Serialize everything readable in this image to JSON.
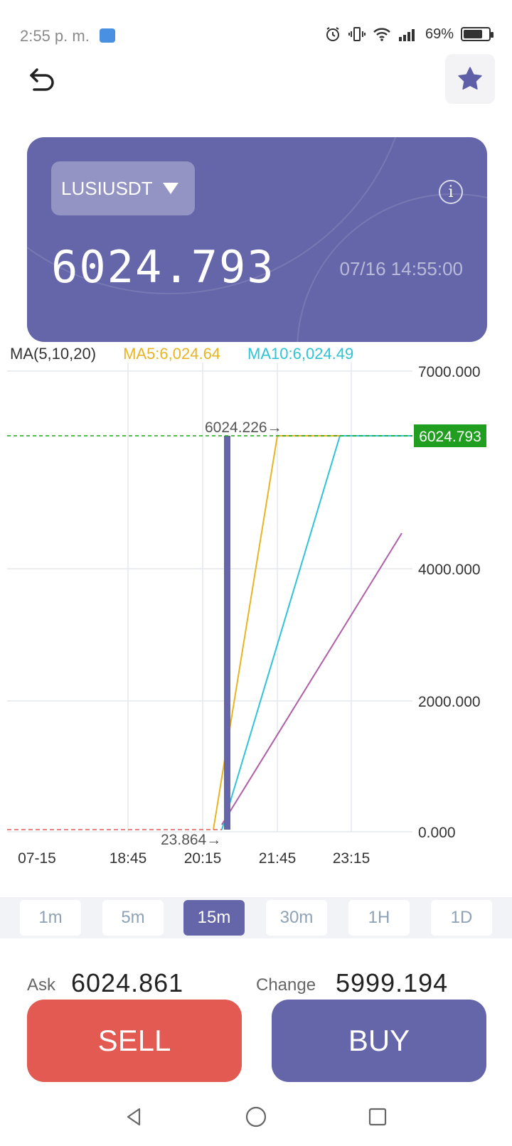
{
  "status_bar": {
    "time": "2:55 p. m.",
    "battery": "69%",
    "icons": [
      "voicemail-icon",
      "alarm-icon",
      "vibrate-icon",
      "wifi-icon",
      "signal-icon",
      "battery-icon"
    ]
  },
  "header": {
    "back_icon": "back-arrow-icon",
    "favorite_icon": "star-icon"
  },
  "ticker": {
    "symbol": "LUSIUSDT",
    "price": "6024.793",
    "timestamp": "07/16 14:55:00",
    "info_icon": "info-icon"
  },
  "indicators": {
    "label": "MA(5,10,20)",
    "ma5": "MA5:6,024.64",
    "ma10": "MA10:6,024.49"
  },
  "chart_data": {
    "type": "candlestick",
    "y_ticks": [
      "7000.000",
      "4000.000",
      "2000.000",
      "0.000"
    ],
    "y_tick_values": [
      7000,
      4000,
      2000,
      0
    ],
    "x_ticks": [
      "07-15",
      "18:45",
      "20:15",
      "21:45",
      "23:15"
    ],
    "current_price_label": "6024.793",
    "current_price": 6024.793,
    "high_marker": "6024.226→",
    "low_marker": "23.864→",
    "colors": {
      "candle": "#6566a9",
      "ma5": "#e8b422",
      "ma10": "#2fc3d8",
      "ma20": "#b05fa8",
      "current_price": "#1aa51a"
    }
  },
  "timeframes": {
    "items": [
      "1m",
      "5m",
      "15m",
      "30m",
      "1H",
      "1D"
    ],
    "active": "15m"
  },
  "stats": {
    "ask_label": "Ask",
    "ask_value": "6024.861",
    "change_label": "Change",
    "change_value": "5999.194"
  },
  "actions": {
    "sell": "SELL",
    "buy": "BUY"
  },
  "nav": [
    "back-nav-icon",
    "home-nav-icon",
    "recents-nav-icon"
  ]
}
